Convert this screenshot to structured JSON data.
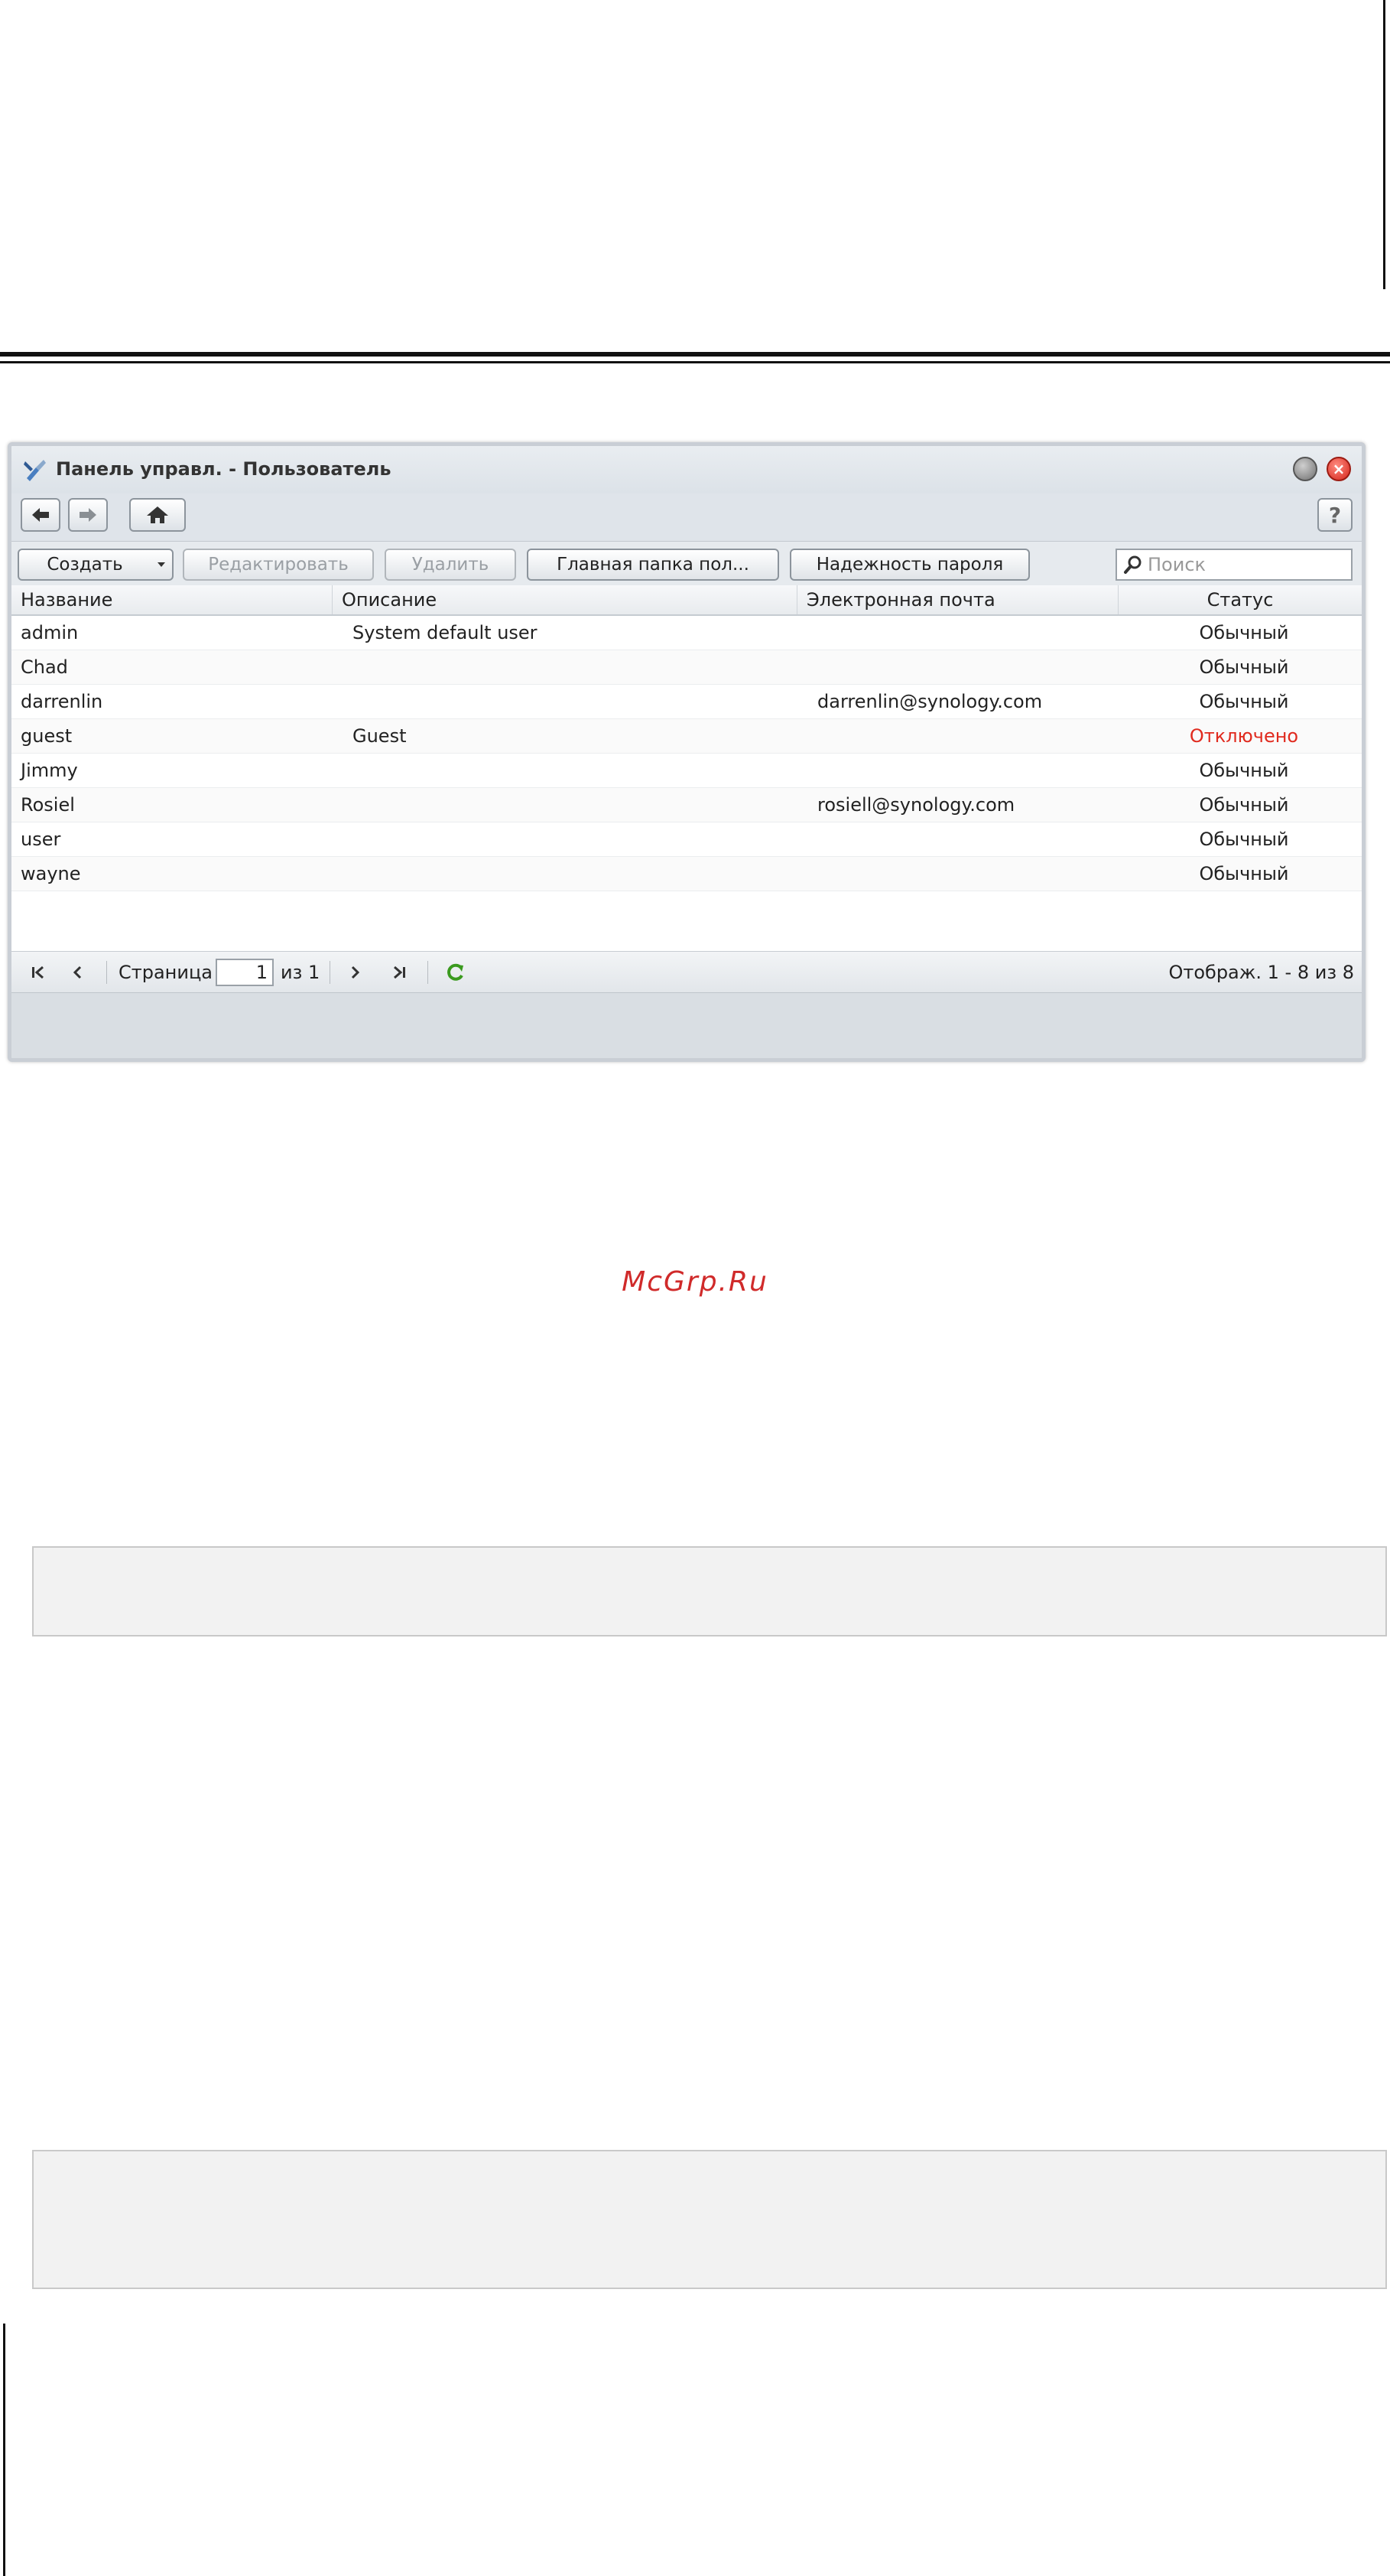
{
  "window": {
    "title": "Панель управл. - Пользователь",
    "close_glyph": "×",
    "help_label": "?"
  },
  "toolbar": {
    "create_label": "Создать",
    "edit_label": "Редактировать",
    "delete_label": "Удалить",
    "home_folder_label": "Главная папка пол...",
    "password_strength_label": "Надежность пароля",
    "search_placeholder": "Поиск"
  },
  "table": {
    "columns": [
      "Название",
      "Описание",
      "Электронная почта",
      "Статус"
    ],
    "rows": [
      {
        "name": "admin",
        "description": "System default user",
        "email": "",
        "status": "Обычный"
      },
      {
        "name": "Chad",
        "description": "",
        "email": "",
        "status": "Обычный"
      },
      {
        "name": "darrenlin",
        "description": "",
        "email": "darrenlin@synology.com",
        "status": "Обычный"
      },
      {
        "name": "guest",
        "description": "Guest",
        "email": "",
        "status": "Отключено"
      },
      {
        "name": "Jimmy",
        "description": "",
        "email": "",
        "status": "Обычный"
      },
      {
        "name": "Rosiel",
        "description": "",
        "email": "rosiell@synology.com",
        "status": "Обычный"
      },
      {
        "name": "user",
        "description": "",
        "email": "",
        "status": "Обычный"
      },
      {
        "name": "wayne",
        "description": "",
        "email": "",
        "status": "Обычный"
      }
    ]
  },
  "pager": {
    "page_label": "Страница",
    "current_page": "1",
    "of_label": "из 1",
    "summary": "Отображ. 1 - 8 из 8"
  },
  "watermark": "McGrp.Ru",
  "colors": {
    "disabled_status": "#e02a1e",
    "refresh_icon": "#3a9a1e"
  }
}
